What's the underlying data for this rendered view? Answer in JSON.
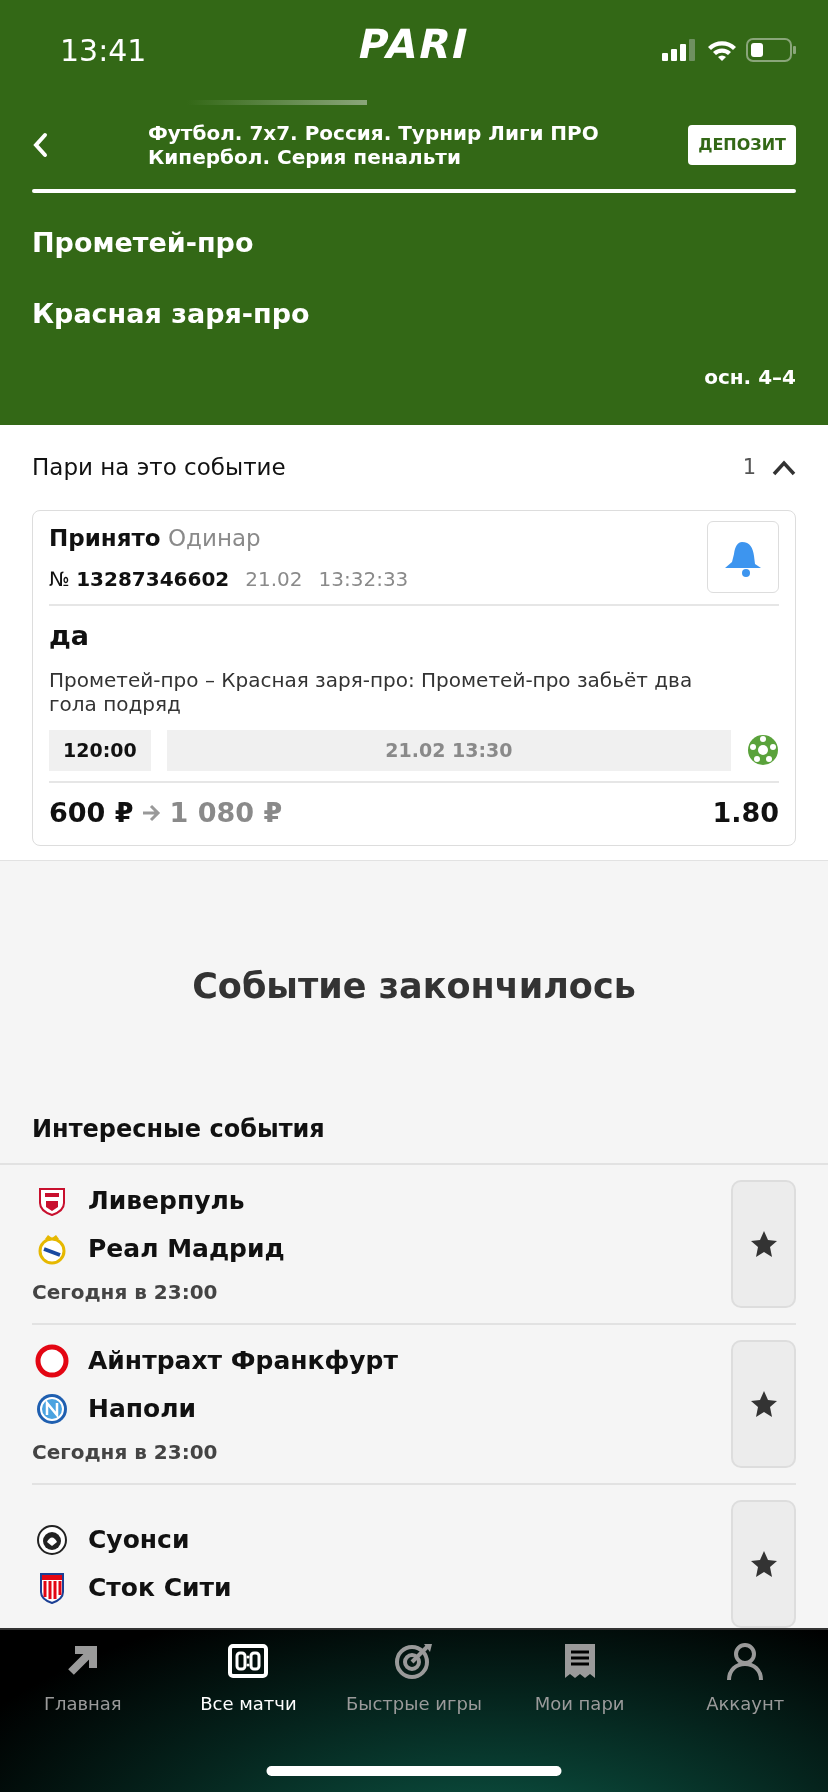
{
  "status_bar": {
    "time": "13:41"
  },
  "header": {
    "logo": "PARI",
    "title": "Футбол. 7x7. Россия. Турнир Лиги ПРО Кипербол. Серия пенальти",
    "deposit_button": "ДЕПОЗИТ",
    "teams": [
      "Прометей-про",
      "Красная заря-про"
    ],
    "score": "осн. 4–4"
  },
  "bets_section": {
    "title": "Пари на это событие",
    "count": "1",
    "expanded": true,
    "bet": {
      "status": "Принято",
      "type": "Одинар",
      "number_label": "№",
      "number": "13287346602",
      "date": "21.02",
      "time": "13:32:33",
      "outcome": "да",
      "description": "Прометей-про – Красная заря-про: Прометей-про забьёт два гола подряд",
      "match_time": "120:00",
      "start": "21.02 13:30",
      "stake": "600 ₽",
      "payout": "1 080 ₽",
      "odds": "1.80"
    }
  },
  "event_ended": "Событие закончилось",
  "interesting": {
    "title": "Интересные события",
    "events": [
      {
        "teams": [
          "Ливерпуль",
          "Реал Мадрид"
        ],
        "time": "Сегодня в 23:00",
        "favorite": false
      },
      {
        "teams": [
          "Айнтрахт Франкфурт",
          "Наполи"
        ],
        "time": "Сегодня в 23:00",
        "favorite": false
      },
      {
        "teams": [
          "Суонси",
          "Сток Сити"
        ],
        "favorite": false
      }
    ]
  },
  "nav": {
    "items": [
      {
        "kind": "home",
        "label": "Главная",
        "selected": false
      },
      {
        "kind": "scoreboard",
        "label": "Все матчи",
        "selected": true
      },
      {
        "kind": "target",
        "label": "Быстрые игры",
        "selected": false
      },
      {
        "kind": "receipt",
        "label": "Мои пари",
        "selected": false
      },
      {
        "kind": "person",
        "label": "Аккаунт",
        "selected": false
      }
    ]
  }
}
